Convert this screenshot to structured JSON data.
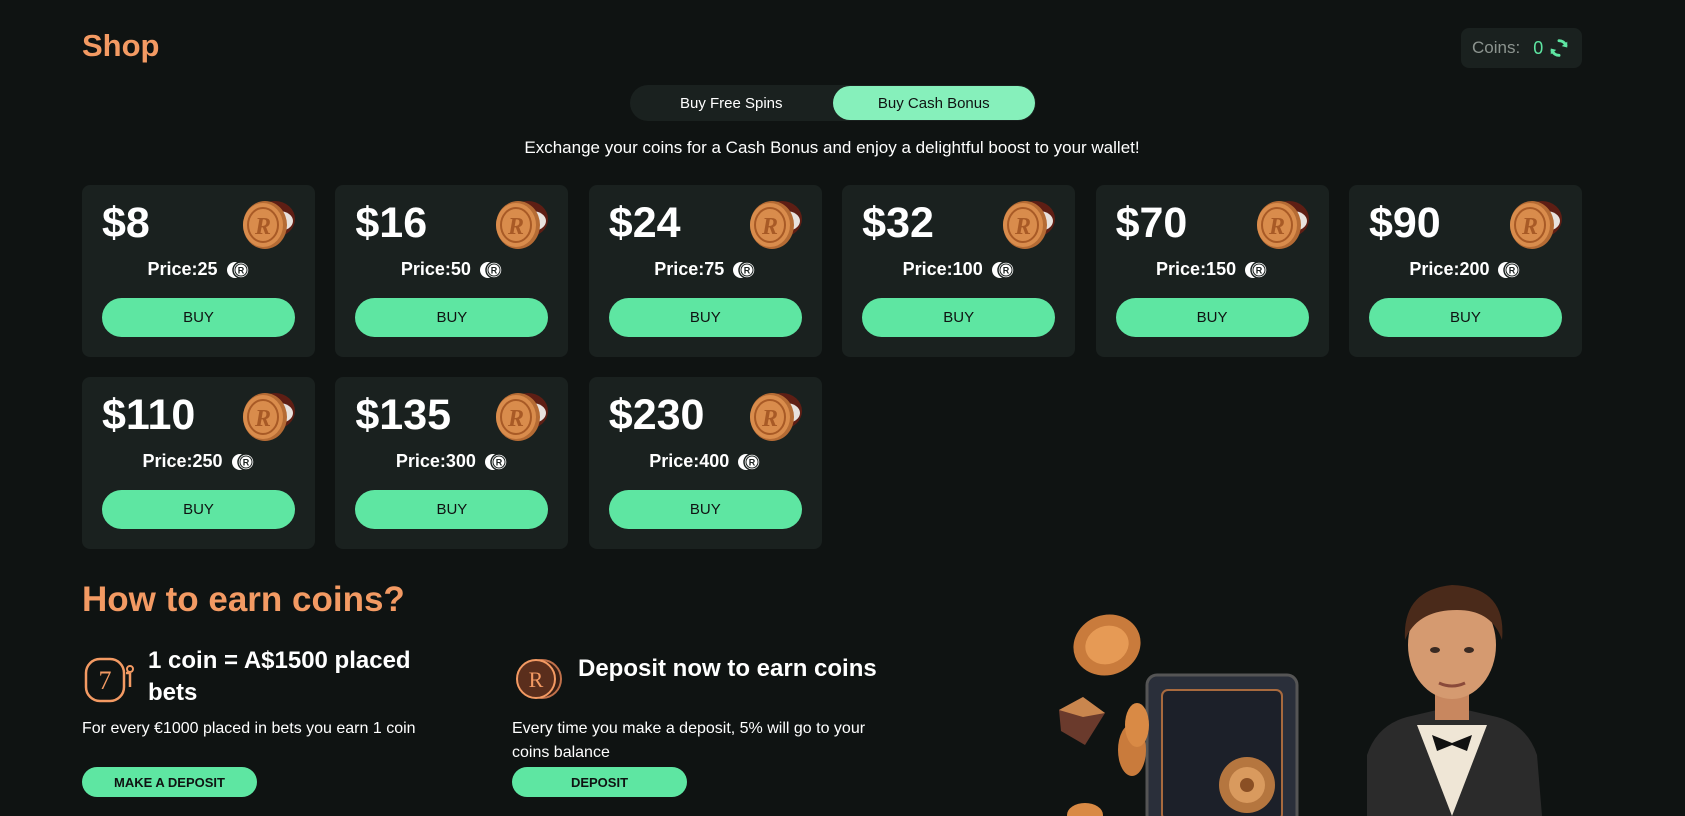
{
  "header": {
    "title": "Shop",
    "coins_label": "Coins:",
    "coins_value": "0"
  },
  "tabs": [
    {
      "label": "Buy Free Spins",
      "active": false
    },
    {
      "label": "Buy Cash Bonus",
      "active": true
    }
  ],
  "subtitle": "Exchange your coins for a Cash Bonus and enjoy a delightful boost to your wallet!",
  "offers": [
    {
      "amount": "$8",
      "price": "Price:25",
      "button": "BUY"
    },
    {
      "amount": "$16",
      "price": "Price:50",
      "button": "BUY"
    },
    {
      "amount": "$24",
      "price": "Price:75",
      "button": "BUY"
    },
    {
      "amount": "$32",
      "price": "Price:100",
      "button": "BUY"
    },
    {
      "amount": "$70",
      "price": "Price:150",
      "button": "BUY"
    },
    {
      "amount": "$90",
      "price": "Price:200",
      "button": "BUY"
    },
    {
      "amount": "$110",
      "price": "Price:250",
      "button": "BUY"
    },
    {
      "amount": "$135",
      "price": "Price:300",
      "button": "BUY"
    },
    {
      "amount": "$230",
      "price": "Price:400",
      "button": "BUY"
    }
  ],
  "earn": {
    "title": "How to earn coins?",
    "blocks": [
      {
        "icon": "slot-machine-icon",
        "heading": "1 coin = A$1500 placed bets",
        "description": "For every €1000 placed in bets you earn 1 coin",
        "button": "MAKE A DEPOSIT"
      },
      {
        "icon": "coin-icon",
        "heading": "Deposit now to earn coins",
        "description": "Every time you make a deposit, 5% will go to your coins balance",
        "button": "DEPOSIT"
      }
    ]
  },
  "colors": {
    "accent": "#5ee6a2",
    "title": "#f39a63",
    "background": "#0f1312",
    "card": "#1a211f"
  }
}
